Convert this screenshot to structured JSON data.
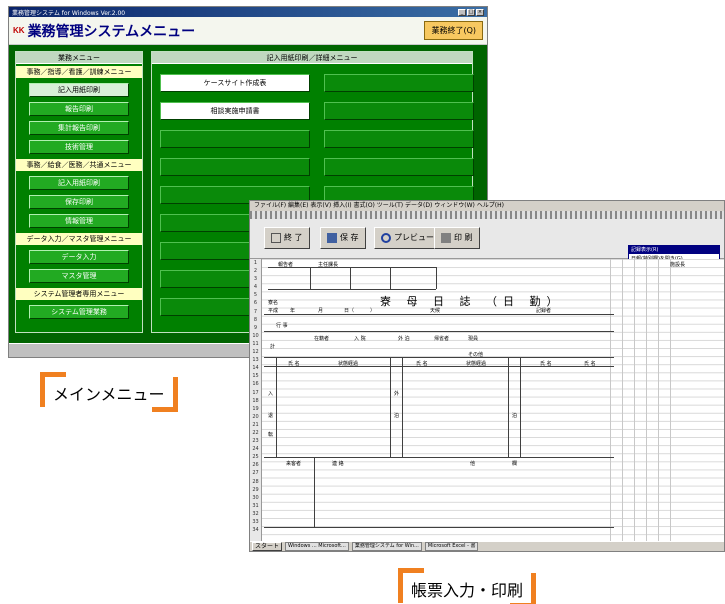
{
  "main_window": {
    "title": "業務管理システム for Windows Ver.2.00",
    "app_title": "業務管理システムメニュー",
    "logo_text": "KK",
    "exit_button": "業務終了(Q)",
    "left_panel": {
      "header": "業務メニュー",
      "sections": [
        {
          "title": "事務／指導／看護／訓練メニュー",
          "items": [
            "記入用紙印刷",
            "報告印刷",
            "集計報告印刷",
            "技術管理"
          ]
        },
        {
          "title": "事務／給食／医務／共通メニュー",
          "items": [
            "記入用紙印刷",
            "保存印刷",
            "情報管理"
          ]
        },
        {
          "title": "データ入力／マスタ管理メニュー",
          "items": [
            "データ入力",
            "マスタ管理"
          ]
        },
        {
          "title": "システム管理者専用メニュー",
          "items": [
            "システム管理業務"
          ]
        }
      ]
    },
    "right_panel": {
      "header": "記入用紙印刷／詳細メニュー",
      "buttons": [
        "ケースサイト作成表",
        "",
        "相談実施申請書",
        "",
        "",
        "",
        "",
        "",
        "",
        "",
        "",
        "",
        "",
        "",
        "",
        "",
        "",
        ""
      ]
    }
  },
  "form_window": {
    "menu": "ファイル(F)  編集(E)  表示(V)  挿入(I)  書式(O)  ツール(T)  データ(D)  ウィンドウ(W)  ヘルプ(H)",
    "toolbar": [
      "終 了",
      "保 存",
      "プレビュー",
      "印 刷"
    ],
    "popup_title": "記録表示(R)",
    "popup_body": "日報(特別欄)を開き(G)",
    "form_title": "寮 母 日 誌 （日 勤）",
    "labels": {
      "reporter": "報告者",
      "headmaster": "主任課長",
      "section": "施設長",
      "ward": "寮名",
      "year": "平成",
      "nen": "年",
      "month": "月",
      "day": "日（",
      "close_paren": "）",
      "weather": "天候",
      "recorder": "記録者",
      "events": "行 事",
      "enrolled": "在籍者",
      "admit": "入 院",
      "outing": "外 泊",
      "home": "帰省者",
      "other": "その他",
      "total": "計",
      "present": "現員",
      "name1": "氏 名",
      "status1": "状態経過",
      "name2": "氏 名",
      "status2": "状態経過",
      "name3": "氏 名",
      "status3": "氏 名",
      "admit_col": "入",
      "retire_col": "退",
      "trans_col": "転",
      "out_col": "外",
      "stay_col": "泊",
      "visitor": "来客者",
      "contact": "連 絡",
      "other2": "他",
      "remark": "欄"
    },
    "taskbar": {
      "start": "スタート",
      "tasks": [
        "Windows ... Microsoft...",
        "業務管理システム for Win...",
        "Microsoft Excel - 書"
      ]
    }
  },
  "callouts": {
    "main_menu": "メインメニュー",
    "form_print": "帳票入力・印刷"
  },
  "colors": {
    "green_bg": "#006400",
    "panel_green": "#008000",
    "accent_orange": "#f08020",
    "title_navy": "#000080"
  }
}
